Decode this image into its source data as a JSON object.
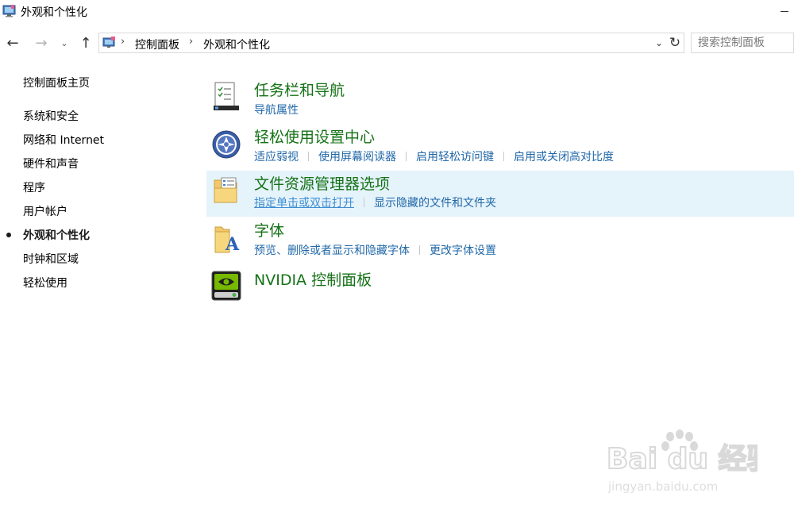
{
  "window": {
    "title": "外观和个性化"
  },
  "nav": {
    "back": "←",
    "forward": "→",
    "recent": "⌄",
    "up": "↑",
    "refresh": "↻",
    "dropdown": "⌄"
  },
  "address": {
    "separator": "›",
    "crumbs": [
      "控制面板",
      "外观和个性化"
    ]
  },
  "search": {
    "placeholder": "搜索控制面板"
  },
  "sidebar": {
    "items": [
      {
        "label": "控制面板主页"
      },
      {
        "label": "系统和安全"
      },
      {
        "label": "网络和 Internet"
      },
      {
        "label": "硬件和声音"
      },
      {
        "label": "程序"
      },
      {
        "label": "用户帐户"
      },
      {
        "label": "外观和个性化",
        "current": true
      },
      {
        "label": "时钟和区域"
      },
      {
        "label": "轻松使用"
      }
    ]
  },
  "categories": [
    {
      "title": "任务栏和导航",
      "icon": "taskbar-icon",
      "links": [
        "导航属性"
      ]
    },
    {
      "title": "轻松使用设置中心",
      "icon": "ease-of-access-icon",
      "links": [
        "适应弱视",
        "使用屏幕阅读器",
        "启用轻松访问键",
        "启用或关闭高对比度"
      ]
    },
    {
      "title": "文件资源管理器选项",
      "icon": "folder-options-icon",
      "links": [
        "指定单击或双击打开",
        "显示隐藏的文件和文件夹"
      ],
      "highlighted": true
    },
    {
      "title": "字体",
      "icon": "fonts-folder-icon",
      "links": [
        "预览、删除或者显示和隐藏字体",
        "更改字体设置"
      ]
    },
    {
      "title": "NVIDIA 控制面板",
      "icon": "nvidia-icon",
      "links": []
    }
  ],
  "watermark": {
    "brand_text": "Bai du 经验",
    "url_text": "jingyan.baidu.com"
  },
  "colors": {
    "category_title": "#157217",
    "link": "#2168a8",
    "highlight_row": "#e5f3fb"
  }
}
